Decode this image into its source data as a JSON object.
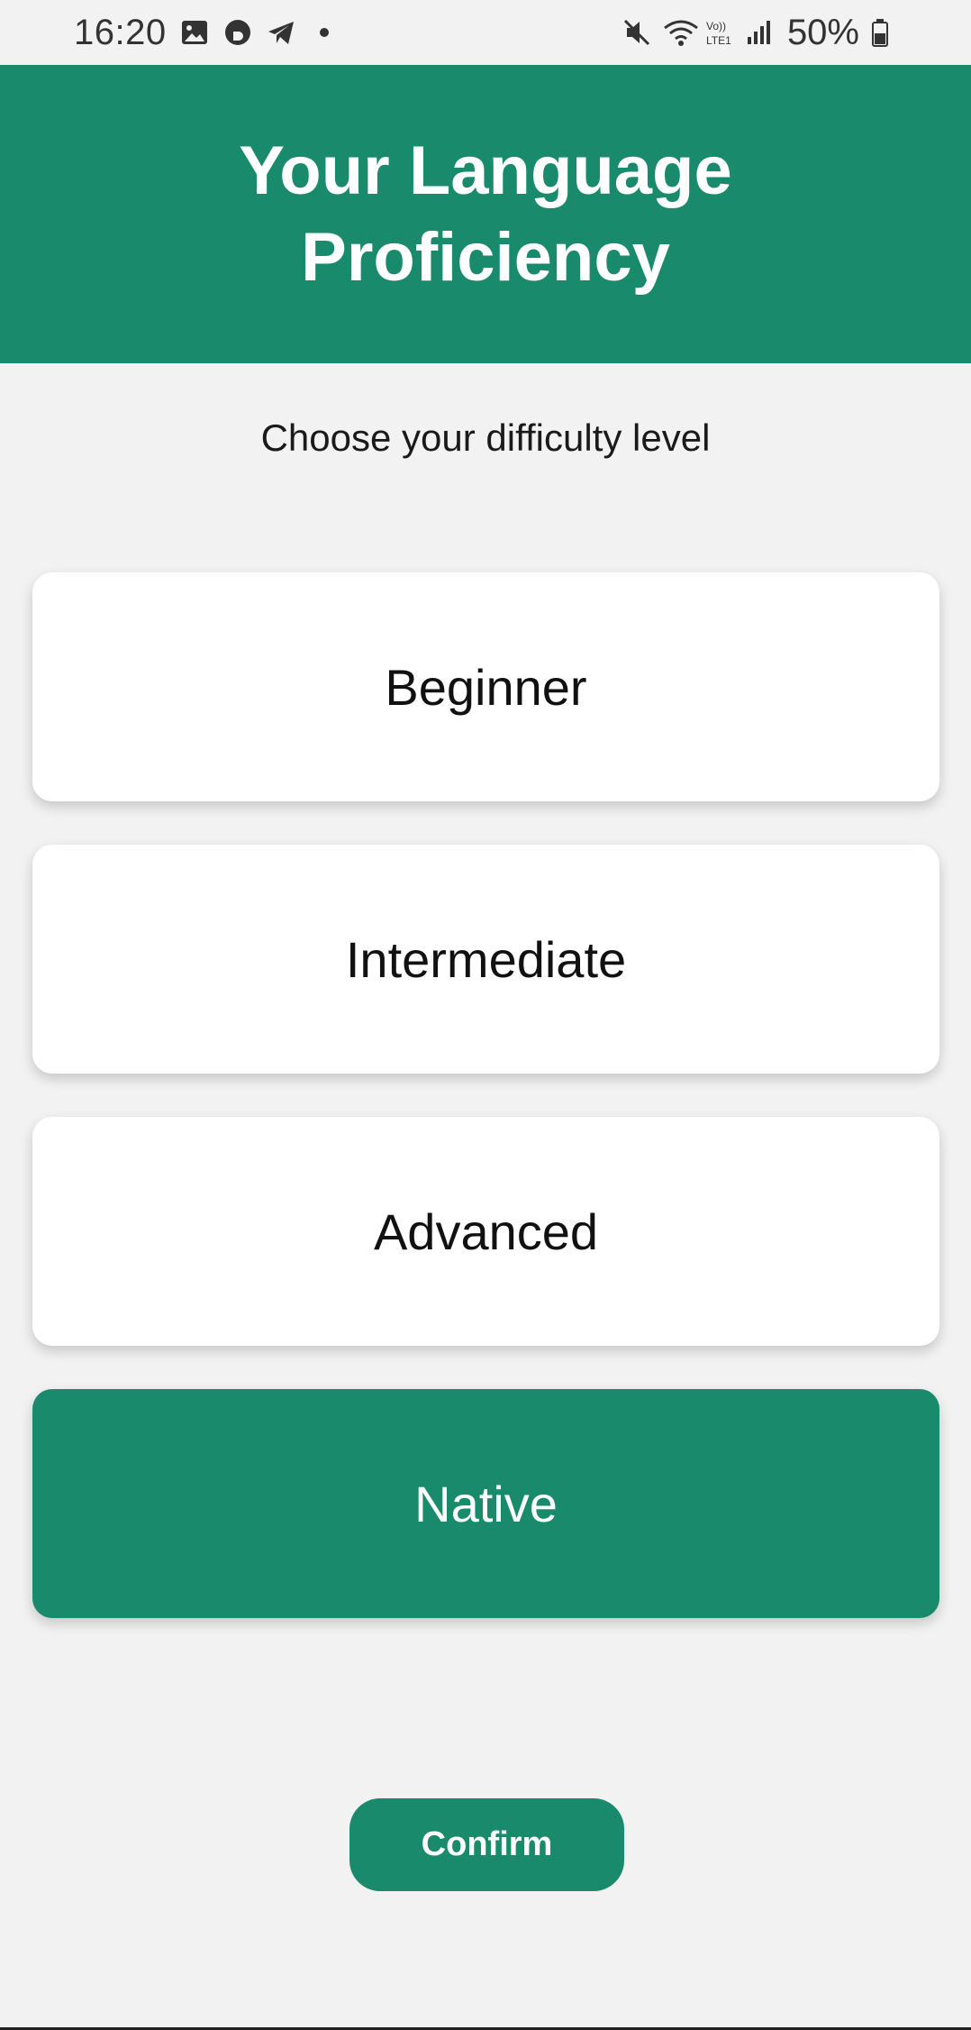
{
  "status_bar": {
    "time": "16:20",
    "battery": "50%",
    "icons_left": [
      "gallery-icon",
      "b-app-icon",
      "telegram-icon",
      "dot-icon"
    ],
    "icons_right": [
      "mute-icon",
      "wifi-icon",
      "volte-icon",
      "signal-icon",
      "battery-icon"
    ]
  },
  "header": {
    "title": "Your Language Proficiency"
  },
  "subtitle": "Choose your difficulty level",
  "options": [
    {
      "label": "Beginner",
      "selected": false
    },
    {
      "label": "Intermediate",
      "selected": false
    },
    {
      "label": "Advanced",
      "selected": false
    },
    {
      "label": "Native",
      "selected": true
    }
  ],
  "confirm_label": "Confirm",
  "colors": {
    "accent": "#198b6c",
    "background": "#f2f2f2",
    "card": "#ffffff"
  }
}
